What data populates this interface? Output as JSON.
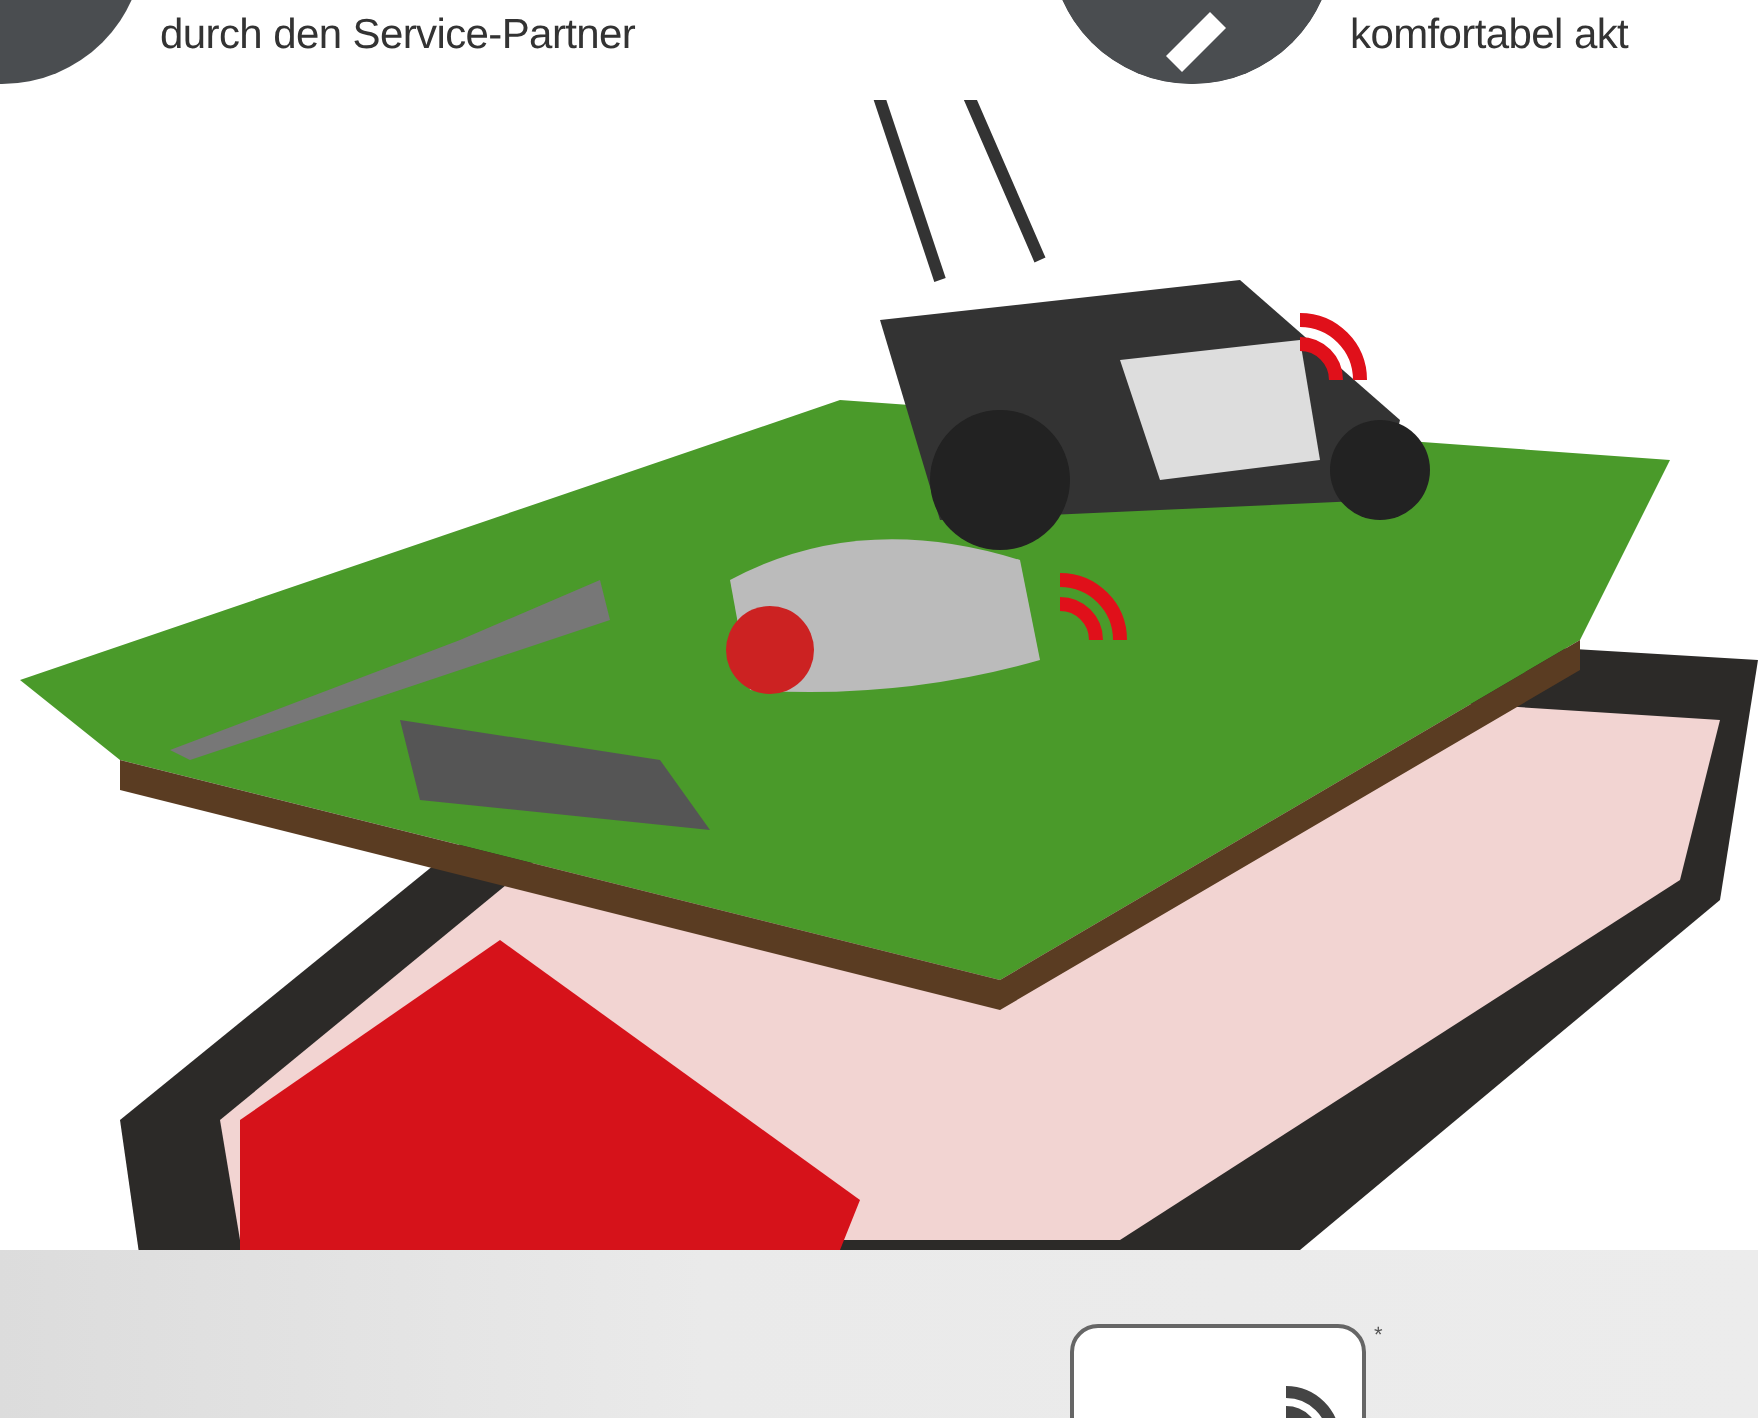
{
  "features": [
    {
      "text": "durch den Service-Partner"
    },
    {
      "text": "komfortabel akt"
    }
  ],
  "badge": {
    "note": "*"
  }
}
